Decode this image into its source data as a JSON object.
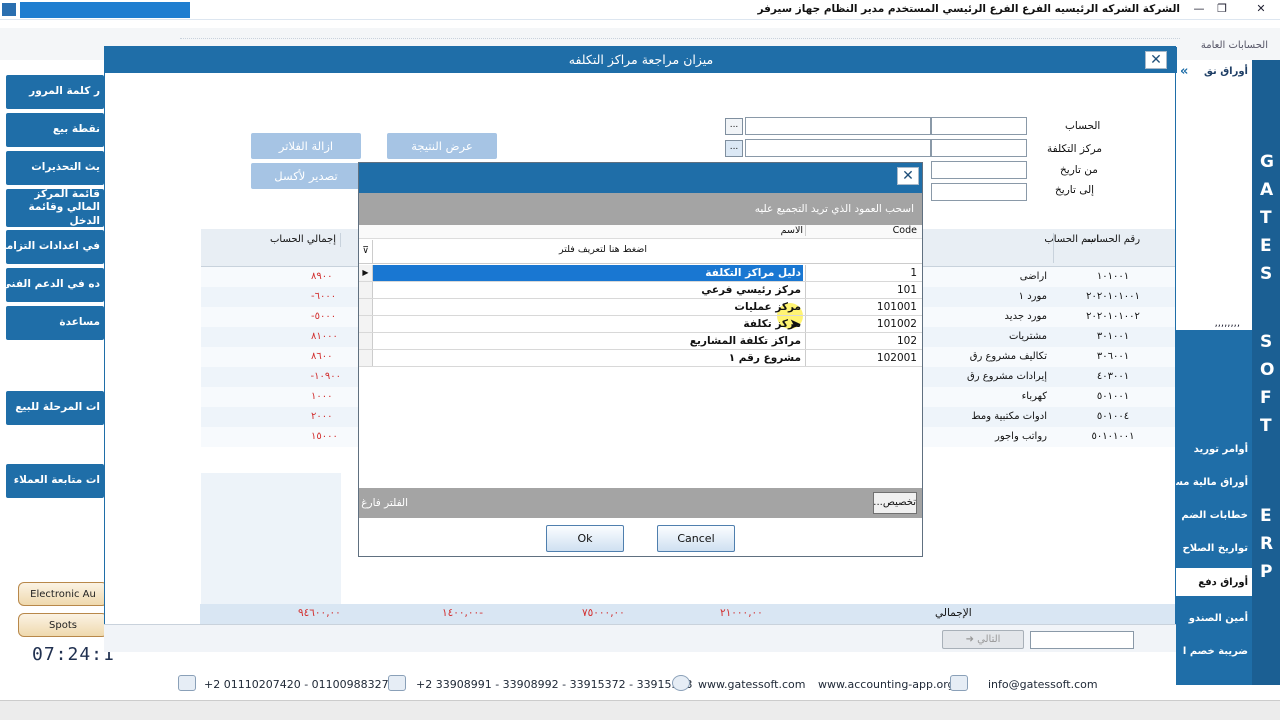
{
  "topbar": {
    "title": "الشركة الشركه الرئيسيه   الفرع الفرع الرئيسي   المستخدم مدير النظام   جهاز سيرفر",
    "minimize": "—",
    "restore": "❐",
    "close": "✕"
  },
  "tabstrip": {
    "general_accounts": "الحسابات العامة"
  },
  "left_buttons": [
    "ر كلمة المرور",
    "نقطة بيع",
    "يث التحذيرات",
    "قائمة المركز المالي وقائمة الدخل",
    "في اعدادات التزامن",
    "ده في الدعم الفني",
    "مساعدة",
    "ات المرحلة للبيع",
    "ات متابعة العملاء"
  ],
  "pill_buttons": [
    "Electronic Au",
    "Spots"
  ],
  "clock": "07:24:1",
  "right_nav": {
    "header_text": "أوراق نق",
    "dots": ",,,,,,,,",
    "items": [
      "أوامر توريد",
      "أوراق مالية مس",
      "خطابات الضم",
      "تواريخ الصلاح",
      "أوراق دفع",
      "أمين الصندو",
      "ضريبة خصم ا"
    ]
  },
  "erp_letters": [
    "G",
    "A",
    "T",
    "E",
    "S",
    "S",
    "O",
    "F",
    "T",
    "E",
    "R",
    "P"
  ],
  "window": {
    "title": "ميزان مراجعة مراكز التكلفه",
    "close": "✕",
    "labels": {
      "account": "الحساب",
      "cost_center": "مركز التكلفة",
      "from_date": "من تاريخ",
      "to_date": "إلى تاريخ"
    },
    "dots_btn": "...",
    "show_result": "عرض النتيجة",
    "clear_filters": "ازالة الفلاتر",
    "export_excel": "تصدير لأكسل",
    "grid_headers": {
      "account_no": "رقم الحساب",
      "account_name": "اسم الحساب",
      "total": "إجمالي الحساب"
    },
    "rows": [
      {
        "no": "١٠١٠٠١",
        "name": "اراضى",
        "total": "٨٩٠٠"
      },
      {
        "no": "٢٠٢٠١٠١٠٠١",
        "name": "مورد ١",
        "total": "٦٠٠٠-"
      },
      {
        "no": "٢٠٢٠١٠١٠٠٢",
        "name": "مورد جديد",
        "total": "٥٠٠٠-"
      },
      {
        "no": "٣٠١٠٠١",
        "name": "مشتريات",
        "total": "٨١٠٠٠"
      },
      {
        "no": "٣٠٦٠٠١",
        "name": "تكاليف مشروع رق",
        "total": "٨٦٠٠"
      },
      {
        "no": "٤٠٣٠٠١",
        "name": "إيرادات مشروع رق",
        "total": "١٠٩٠٠-"
      },
      {
        "no": "٥٠١٠٠١",
        "name": "كهرباء",
        "total": "١٠٠٠"
      },
      {
        "no": "٥٠١٠٠٤",
        "name": "ادوات مكتبية ومط",
        "total": "٢٠٠٠"
      },
      {
        "no": "٥٠١٠١٠٠١",
        "name": "رواتب واجور",
        "total": "١٥٠٠٠"
      }
    ],
    "totals_label": "الإجمالي",
    "totals": [
      "٢١٠٠٠,٠٠",
      "٧٥٠٠٠,٠٠",
      "١٤٠٠,٠٠-",
      "٩٤٦٠٠,٠٠"
    ],
    "next_btn": "التالي"
  },
  "dialog": {
    "close": "✕",
    "group_hint": "اسحب العمود الذي تريد التجميع عليه",
    "col_code": "Code",
    "col_name": "الاسم",
    "filter_hint": "اضغط هنا لتعريف فلتر",
    "rows": [
      {
        "code": "1",
        "name": "دليل مراكز التكلفة"
      },
      {
        "code": "101",
        "name": "مركز رئيسي فرعي"
      },
      {
        "code": "101001",
        "name": "مركز عمليات"
      },
      {
        "code": "101002",
        "name": "مركز تكلفة"
      },
      {
        "code": "102",
        "name": "مراكز تكلفة المشاريع"
      },
      {
        "code": "102001",
        "name": "مشروع رقم ١"
      }
    ],
    "filter_status": "الفلتر فارغ",
    "customize": "تخصيص...",
    "ok": "Ok",
    "cancel": "Cancel"
  },
  "footer": {
    "mobile": "+2 01110207420 - 01100988327",
    "phone": "+2 33908991 - 33908992 - 33915372 - 33915373",
    "site1": "www.gatessoft.com",
    "site2": "www.accounting-app.org",
    "email": "info@gatessoft.com"
  }
}
